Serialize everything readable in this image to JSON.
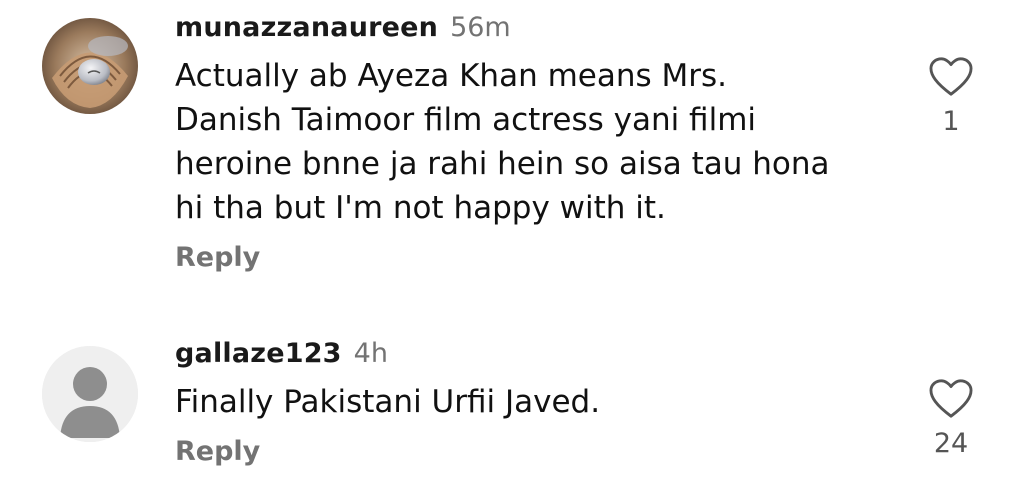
{
  "comments": [
    {
      "username": "munazzanaureen",
      "time": "56m",
      "text": "Actually ab Ayeza Khan means Mrs.\nDanish Taimoor film actress yani filmi\nheroine bnne ja rahi hein so aisa tau hona\nhi tha but I'm not happy with it.",
      "reply_label": "Reply",
      "like_count": "1",
      "avatar": "seashell-image-avatar"
    },
    {
      "username": "gallaze123",
      "time": "4h",
      "text": "Finally Pakistani Urfii Javed.",
      "reply_label": "Reply",
      "like_count": "24",
      "avatar": "default-user-avatar"
    }
  ],
  "icons": {
    "like": "heart-outline-icon"
  },
  "colors": {
    "text": "#111111",
    "muted": "#737373",
    "default_avatar_bg": "#efefef",
    "default_avatar_fg": "#8e8e8e"
  }
}
